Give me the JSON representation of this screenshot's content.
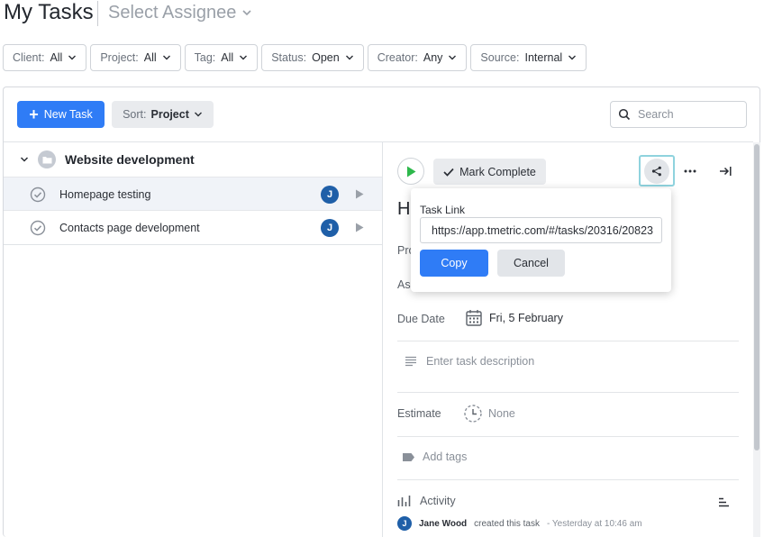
{
  "header": {
    "title": "My Tasks",
    "assignee_placeholder": "Select Assignee"
  },
  "filters": [
    {
      "label": "Client:",
      "value": "All"
    },
    {
      "label": "Project:",
      "value": "All"
    },
    {
      "label": "Tag:",
      "value": "All"
    },
    {
      "label": "Status:",
      "value": "Open"
    },
    {
      "label": "Creator:",
      "value": "Any"
    },
    {
      "label": "Source:",
      "value": "Internal"
    }
  ],
  "toolbar": {
    "new_task_label": "New Task",
    "sort_label": "Sort:",
    "sort_value": "Project",
    "search_placeholder": "Search"
  },
  "task_list": {
    "group_name": "Website development",
    "tasks": [
      {
        "name": "Homepage testing",
        "assignee_initial": "J",
        "selected": true
      },
      {
        "name": "Contacts page development",
        "assignee_initial": "J",
        "selected": false
      }
    ]
  },
  "detail": {
    "mark_complete_label": "Mark Complete",
    "title_peek": "H",
    "project_label_peek": "Pro",
    "assignee_label_peek": "Ass",
    "due_date_label": "Due Date",
    "due_date_value": "Fri, 5 February",
    "description_placeholder": "Enter task description",
    "estimate_label": "Estimate",
    "estimate_value": "None",
    "add_tags_label": "Add tags",
    "activity_label": "Activity",
    "activity_entry": {
      "avatar_initial": "J",
      "user": "Jane Wood",
      "action": "created this task",
      "time": "- Yesterday at 10:46 am"
    }
  },
  "share_popover": {
    "label": "Task Link",
    "link": "https://app.tmetric.com/#/tasks/20316/20823",
    "copy_label": "Copy",
    "cancel_label": "Cancel"
  },
  "colors": {
    "accent": "#2f7cf6",
    "avatar": "#1f5fa8",
    "play_green": "#2db84b",
    "share_highlight": "#8fd3de"
  }
}
